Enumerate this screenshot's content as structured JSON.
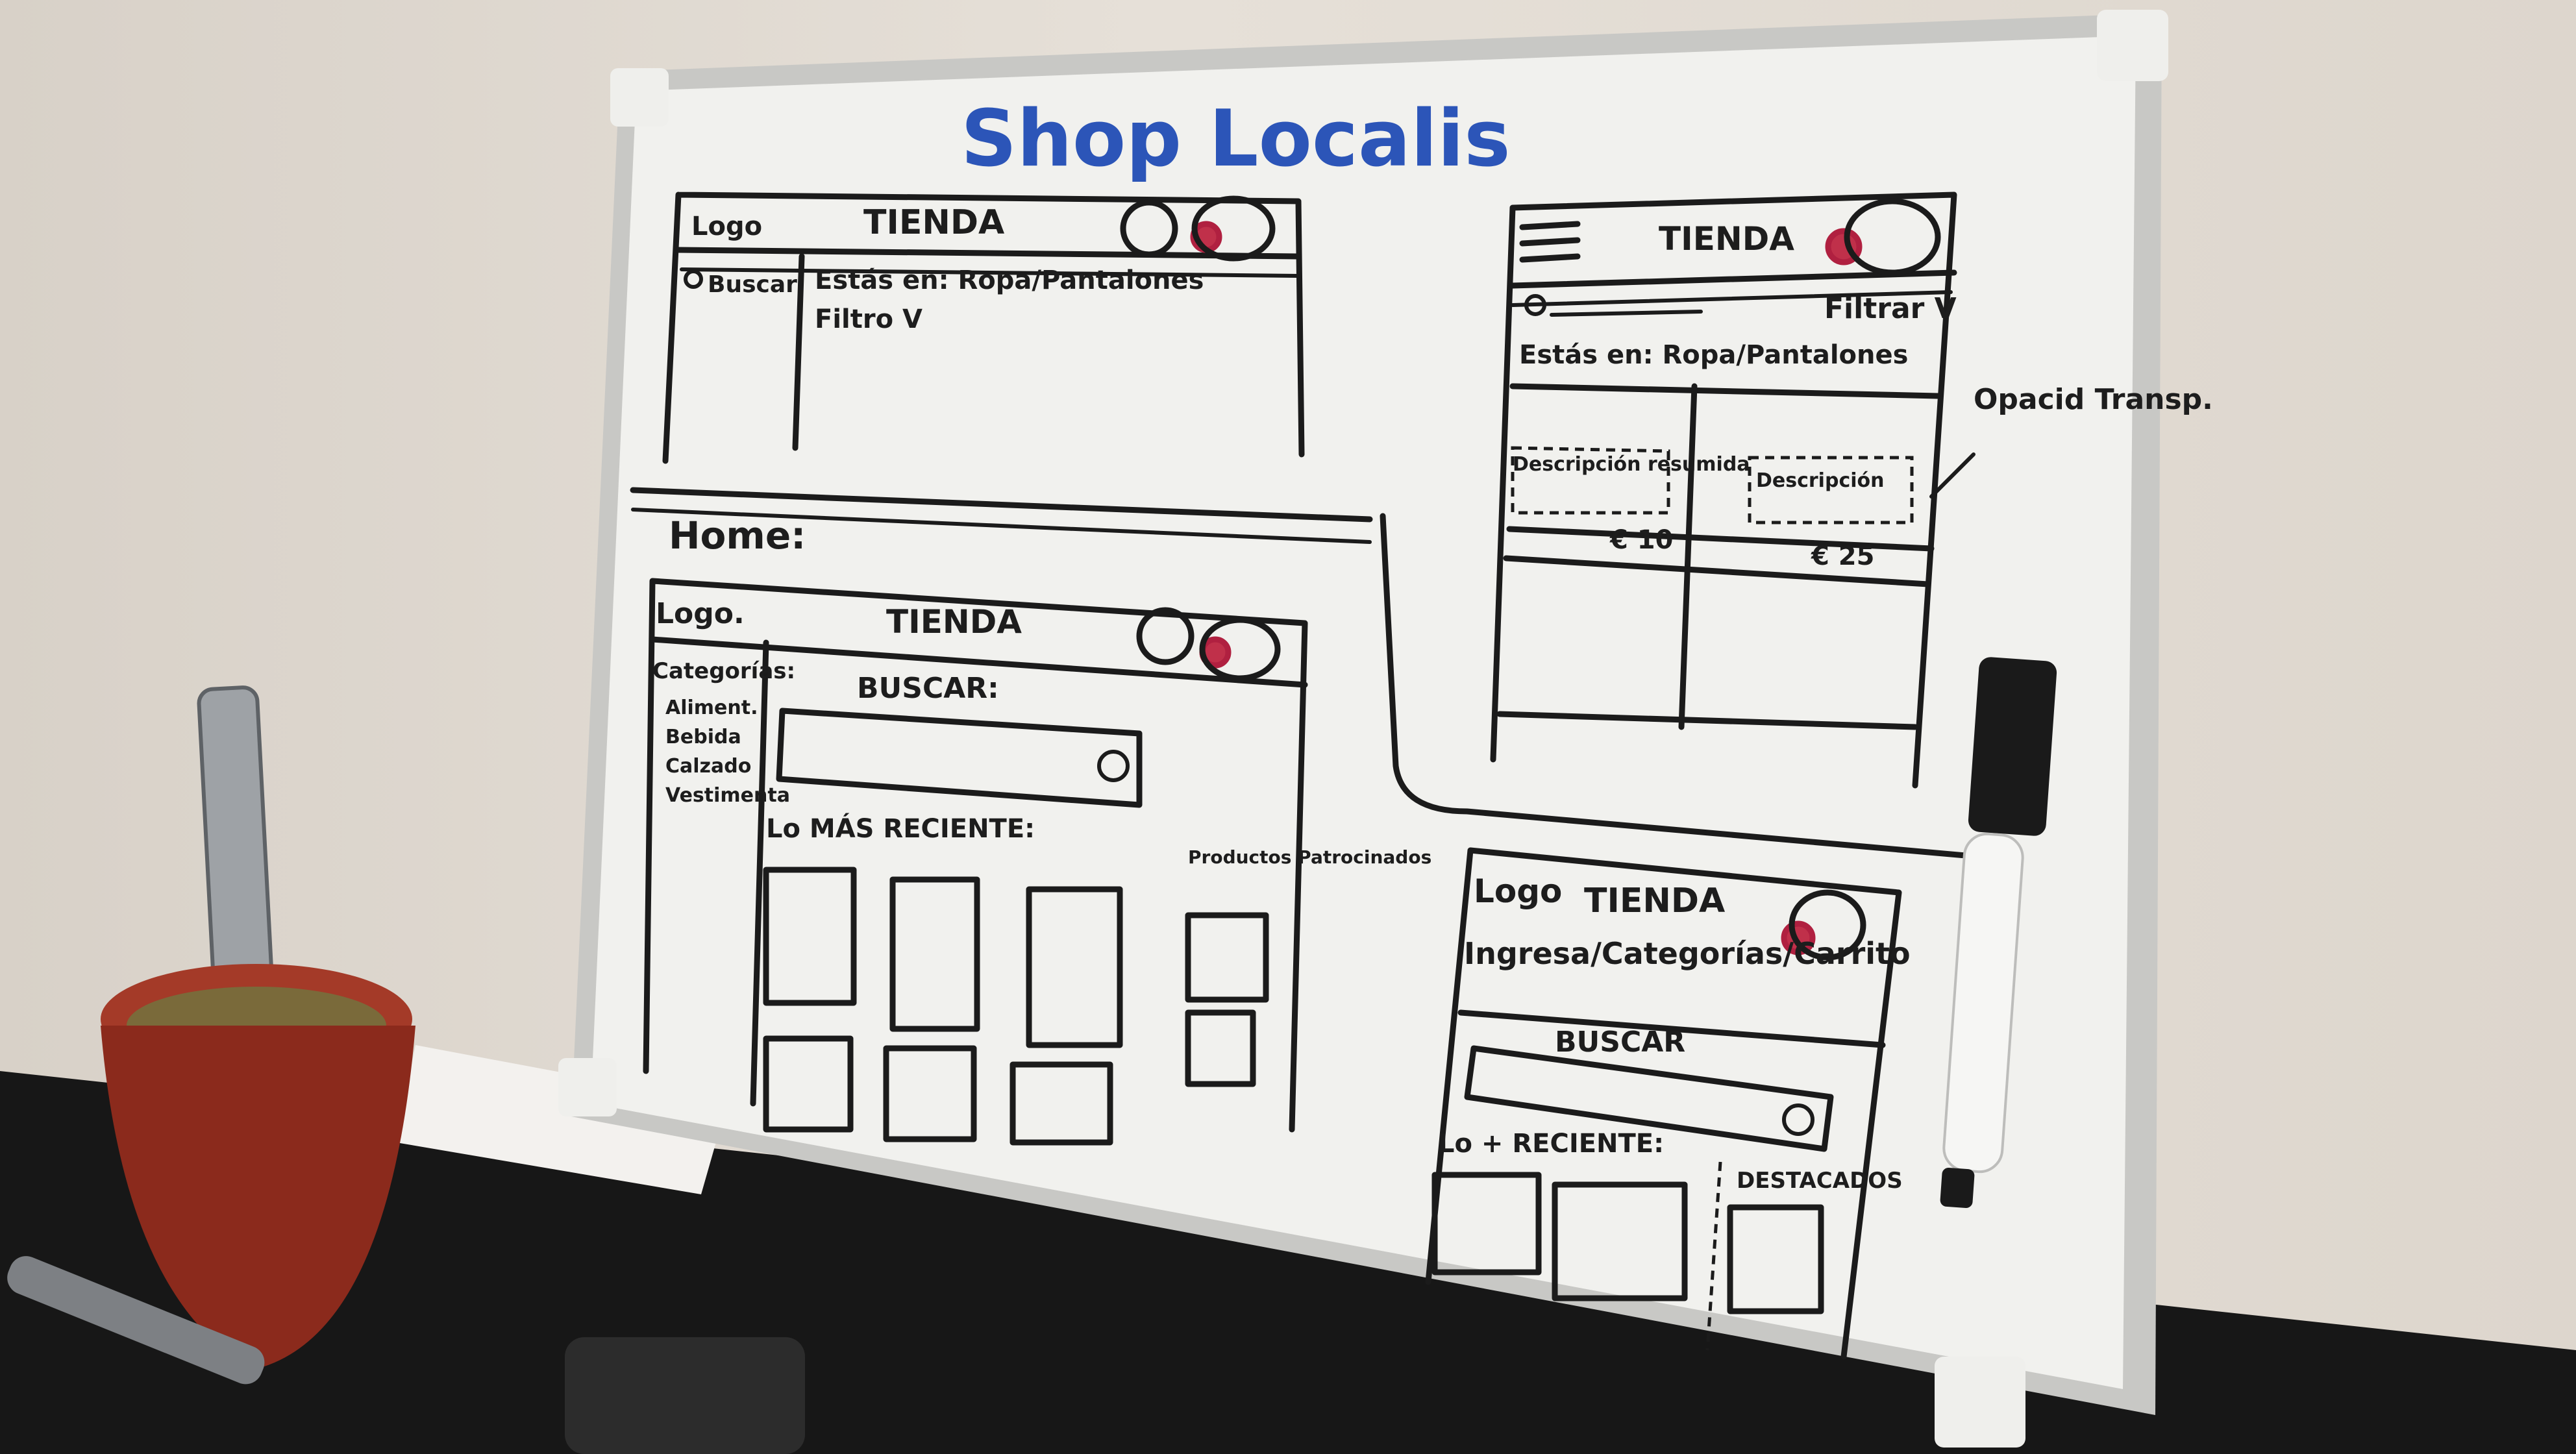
{
  "board": {
    "title": "Shop Localis",
    "home_label": "Home:"
  },
  "sketch_top_left": {
    "logo": "Logo",
    "store": "TIENDA",
    "search": "Buscar",
    "breadcrumb": "Estás en: Ropa/Pantalones",
    "filter": "Filtro V"
  },
  "sketch_home": {
    "logo": "Logo.",
    "store": "TIENDA",
    "categories_title": "Categorías:",
    "categories": [
      "Aliment.",
      "Bebida",
      "Calzado",
      "Vestimenta"
    ],
    "search_label": "BUSCAR:",
    "recent_label": "Lo MÁS RECIENTE:",
    "sponsored_label": "Productos Patrocinados"
  },
  "sketch_mobile_list": {
    "store": "TIENDA",
    "filter": "Filtrar V",
    "breadcrumb": "Estás en: Ropa/Pantalones",
    "product_1_desc": "Descripción resumida",
    "product_2_desc": "Descripción",
    "price_1": "€ 10",
    "price_2": "€ 25",
    "note": "Opacid Transp."
  },
  "sketch_mobile_home": {
    "logo": "Logo",
    "store": "TIENDA",
    "nav": "Ingresa/Categorías/Carrito",
    "search_label": "BUSCAR",
    "recent_label": "Lo + RECIENTE:",
    "featured_label": "DESTACADOS"
  },
  "colors": {
    "board": "#f1f1ee",
    "frame": "#c9c9c6",
    "ink": "#1b1b1b",
    "title_ink": "#2c55b8",
    "accent_red": "#c0304a",
    "mate_cup": "#8b2a1c",
    "desk": "#161616"
  },
  "icons": [
    "user-icon",
    "cart-icon",
    "search-icon",
    "hamburger-menu-icon",
    "marker-pen"
  ]
}
